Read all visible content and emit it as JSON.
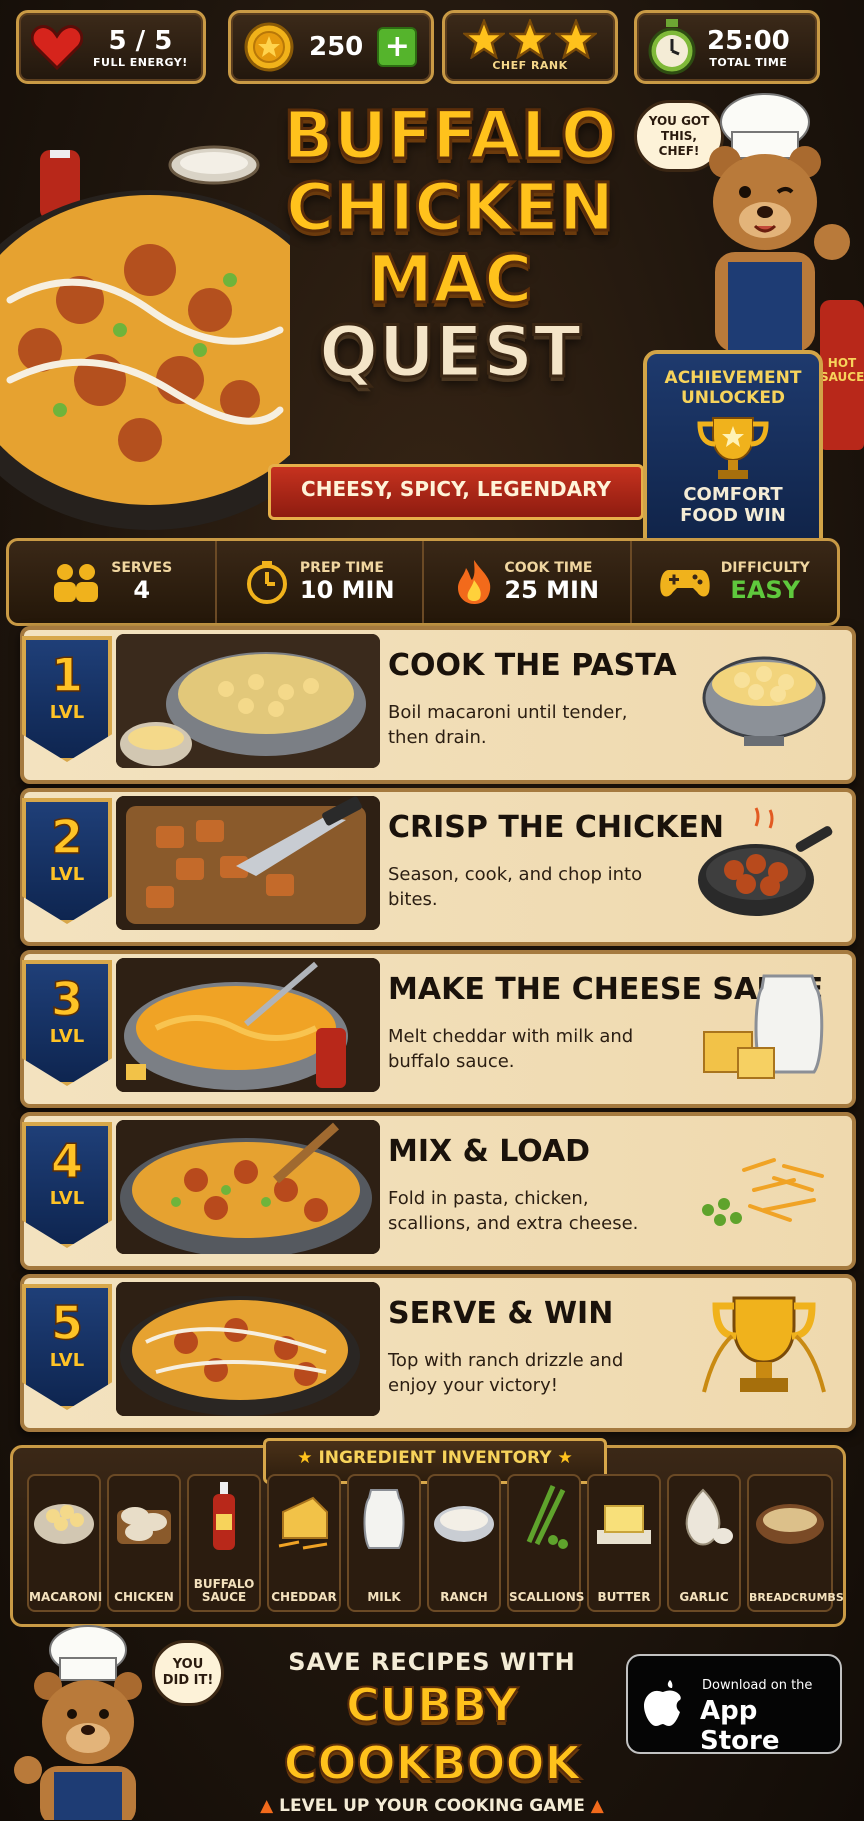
{
  "hud": {
    "energy": {
      "value": "5 / 5",
      "label": "FULL ENERGY!"
    },
    "coins": {
      "value": "250"
    },
    "rank": {
      "label": "CHEF RANK",
      "stars": 3
    },
    "timer": {
      "value": "25:00",
      "label": "TOTAL TIME"
    }
  },
  "title": {
    "line1": "BUFFALO",
    "line2": "CHICKEN",
    "line3": "MAC",
    "line4": "QUEST",
    "ribbon": "CHEESY, SPICY, LEGENDARY"
  },
  "mascot_top": {
    "speech": "YOU GOT THIS, CHEF!"
  },
  "hot_sauce_label": "HOT SAUCE",
  "achievement": {
    "line1": "ACHIEVEMENT",
    "line2": "UNLOCKED",
    "line3": "COMFORT",
    "line4": "FOOD WIN"
  },
  "info": [
    {
      "label": "SERVES",
      "value": "4",
      "icon": "people-icon"
    },
    {
      "label": "PREP TIME",
      "value": "10 MIN",
      "icon": "timer-icon"
    },
    {
      "label": "COOK TIME",
      "value": "25 MIN",
      "icon": "flame-icon"
    },
    {
      "label": "DIFFICULTY",
      "value": "EASY",
      "icon": "gamepad-icon"
    }
  ],
  "steps": [
    {
      "level": "1",
      "lvl": "LVL",
      "title": "COOK THE PASTA",
      "desc": "Boil macaroni until tender, then drain."
    },
    {
      "level": "2",
      "lvl": "LVL",
      "title": "CRISP THE CHICKEN",
      "desc": "Season, cook, and chop into bites."
    },
    {
      "level": "3",
      "lvl": "LVL",
      "title": "MAKE THE CHEESE SAUCE",
      "desc": "Melt cheddar with milk and buffalo sauce."
    },
    {
      "level": "4",
      "lvl": "LVL",
      "title": "MIX & LOAD",
      "desc": "Fold in pasta, chicken, scallions, and extra cheese."
    },
    {
      "level": "5",
      "lvl": "LVL",
      "title": "SERVE & WIN",
      "desc": "Top with ranch drizzle and enjoy your victory!"
    }
  ],
  "inventory": {
    "title": "INGREDIENT INVENTORY",
    "items": [
      "MACARONI",
      "CHICKEN",
      "BUFFALO SAUCE",
      "CHEDDAR",
      "MILK",
      "RANCH",
      "SCALLIONS",
      "BUTTER",
      "GARLIC",
      "BREADCRUMBS"
    ]
  },
  "footer": {
    "speech": "YOU DID IT!",
    "line1": "SAVE RECIPES WITH",
    "brand": "CUBBY COOKBOOK",
    "line3": "LEVEL UP YOUR COOKING GAME",
    "store_small": "Download on the",
    "store_big": "App Store"
  },
  "colors": {
    "gold": "#ffc21c",
    "navy": "#1f3f78",
    "parchment": "#f3e2bf",
    "easy": "#5fc93d"
  }
}
